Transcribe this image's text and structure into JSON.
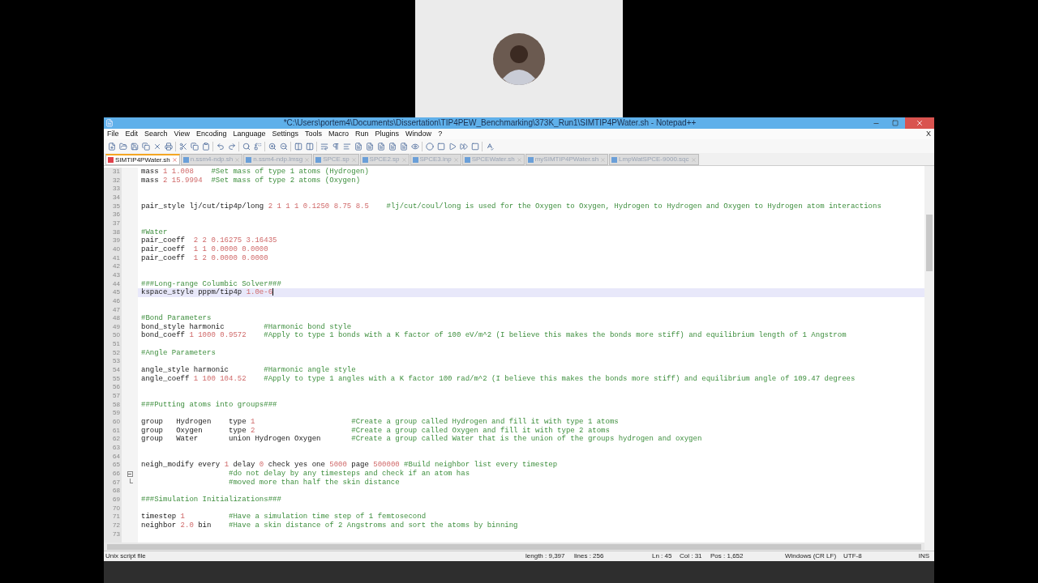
{
  "window": {
    "title": "*C:\\Users\\portem4\\Documents\\Dissertation\\TIP4PEW_Benchmarking\\373K_Run1\\SIMTIP4PWater.sh - Notepad++"
  },
  "menu": [
    "File",
    "Edit",
    "Search",
    "View",
    "Encoding",
    "Language",
    "Settings",
    "Tools",
    "Macro",
    "Run",
    "Plugins",
    "Window",
    "?"
  ],
  "menu_close": "X",
  "tabs": [
    {
      "label": "SIMTIP4PWater.sh",
      "selected": true
    },
    {
      "label": "n.ssm4-ndp.sh",
      "selected": false
    },
    {
      "label": "n.ssm4-ndp.lmsg",
      "selected": false
    },
    {
      "label": "SPCE.sp",
      "selected": false
    },
    {
      "label": "SPCE2.sp",
      "selected": false
    },
    {
      "label": "SPCE3.inp",
      "selected": false
    },
    {
      "label": "SPCEWater.sh",
      "selected": false
    },
    {
      "label": "mySIMTIP4PWater.sh",
      "selected": false
    },
    {
      "label": "LmpWatSPCE-9000.sqc",
      "selected": false
    }
  ],
  "editor": {
    "lines": [
      {
        "number": "31",
        "current": false,
        "segments": [
          {
            "kind": "code",
            "text": "mass "
          },
          {
            "kind": "number",
            "text": "1 1.008"
          },
          {
            "kind": "comment",
            "text": "    #Set mass of type 1 atoms (Hydrogen)"
          }
        ]
      },
      {
        "number": "32",
        "current": false,
        "segments": [
          {
            "kind": "code",
            "text": "mass "
          },
          {
            "kind": "number",
            "text": "2 15.9994"
          },
          {
            "kind": "comment",
            "text": "  #Set mass of type 2 atoms (Oxygen)"
          }
        ]
      },
      {
        "number": "33",
        "current": false
      },
      {
        "number": "34",
        "current": false
      },
      {
        "number": "35",
        "current": false,
        "segments": [
          {
            "kind": "code",
            "text": "pair_style lj/cut/tip4p/long "
          },
          {
            "kind": "number",
            "text": "2 1 1 1 0.1250 8.75 8.5"
          },
          {
            "kind": "comment",
            "text": "    #lj/cut/coul/long is used for the Oxygen to Oxygen, Hydrogen to Hydrogen and Oxygen to Hydrogen atom interactions"
          }
        ]
      },
      {
        "number": "36",
        "current": false
      },
      {
        "number": "37",
        "current": false
      },
      {
        "number": "38",
        "current": false,
        "segments": [
          {
            "kind": "comment",
            "text": "#Water"
          }
        ]
      },
      {
        "number": "39",
        "current": false,
        "segments": [
          {
            "kind": "code",
            "text": "pair_coeff  "
          },
          {
            "kind": "number",
            "text": "2 2 0.16275 3.16435"
          }
        ]
      },
      {
        "number": "40",
        "current": false,
        "segments": [
          {
            "kind": "code",
            "text": "pair_coeff  "
          },
          {
            "kind": "number",
            "text": "1 1 0.0000 0.0000"
          }
        ]
      },
      {
        "number": "41",
        "current": false,
        "segments": [
          {
            "kind": "code",
            "text": "pair_coeff  "
          },
          {
            "kind": "number",
            "text": "1 2 0.0000 0.0000"
          }
        ]
      },
      {
        "number": "42",
        "current": false
      },
      {
        "number": "43",
        "current": false
      },
      {
        "number": "44",
        "current": false,
        "segments": [
          {
            "kind": "comment",
            "text": "###Long-range Columbic Solver###"
          }
        ]
      },
      {
        "number": "45",
        "current": true,
        "segments": [
          {
            "kind": "code",
            "text": "kspace_style pppm/tip4p "
          },
          {
            "kind": "number",
            "text": "1.0e-6"
          }
        ]
      },
      {
        "number": "46",
        "current": false
      },
      {
        "number": "47",
        "current": false
      },
      {
        "number": "48",
        "current": false,
        "segments": [
          {
            "kind": "comment",
            "text": "#Bond Parameters"
          }
        ]
      },
      {
        "number": "49",
        "current": false,
        "segments": [
          {
            "kind": "code",
            "text": "bond_style harmonic"
          },
          {
            "kind": "comment",
            "text": "         #Harmonic bond style"
          }
        ]
      },
      {
        "number": "50",
        "current": false,
        "segments": [
          {
            "kind": "code",
            "text": "bond_coeff "
          },
          {
            "kind": "number",
            "text": "1 1000 0.9572"
          },
          {
            "kind": "comment",
            "text": "    #Apply to type 1 bonds with a K factor of 100 eV/m^2 (I believe this makes the bonds more stiff) and equilibrium length of 1 Angstrom"
          }
        ]
      },
      {
        "number": "51",
        "current": false
      },
      {
        "number": "52",
        "current": false,
        "segments": [
          {
            "kind": "comment",
            "text": "#Angle Parameters"
          }
        ]
      },
      {
        "number": "53",
        "current": false
      },
      {
        "number": "54",
        "current": false,
        "segments": [
          {
            "kind": "code",
            "text": "angle_style harmonic"
          },
          {
            "kind": "comment",
            "text": "        #Harmonic angle style"
          }
        ]
      },
      {
        "number": "55",
        "current": false,
        "segments": [
          {
            "kind": "code",
            "text": "angle_coeff "
          },
          {
            "kind": "number",
            "text": "1 100 104.52"
          },
          {
            "kind": "comment",
            "text": "    #Apply to type 1 angles with a K factor 100 rad/m^2 (I believe this makes the bonds more stiff) and equilibrium angle of 109.47 degrees"
          }
        ]
      },
      {
        "number": "56",
        "current": false
      },
      {
        "number": "57",
        "current": false
      },
      {
        "number": "58",
        "current": false,
        "segments": [
          {
            "kind": "comment",
            "text": "###Putting atoms into groups###"
          }
        ]
      },
      {
        "number": "59",
        "current": false
      },
      {
        "number": "60",
        "current": false,
        "segments": [
          {
            "kind": "code",
            "text": "group   Hydrogen    type "
          },
          {
            "kind": "number",
            "text": "1"
          },
          {
            "kind": "comment",
            "text": "                      #Create a group called Hydrogen and fill it with type 1 atoms"
          }
        ]
      },
      {
        "number": "61",
        "current": false,
        "segments": [
          {
            "kind": "code",
            "text": "group   Oxygen      type "
          },
          {
            "kind": "number",
            "text": "2"
          },
          {
            "kind": "comment",
            "text": "                      #Create a group called Oxygen and fill it with type 2 atoms"
          }
        ]
      },
      {
        "number": "62",
        "current": false,
        "segments": [
          {
            "kind": "code",
            "text": "group   Water       union Hydrogen Oxygen"
          },
          {
            "kind": "comment",
            "text": "       #Create a group called Water that is the union of the groups hydrogen and oxygen"
          }
        ]
      },
      {
        "number": "63",
        "current": false
      },
      {
        "number": "64",
        "current": false
      },
      {
        "number": "65",
        "current": false,
        "segments": [
          {
            "kind": "code",
            "text": "neigh_modify every "
          },
          {
            "kind": "number",
            "text": "1"
          },
          {
            "kind": "code",
            "text": " delay "
          },
          {
            "kind": "number",
            "text": "0"
          },
          {
            "kind": "code",
            "text": " check yes one "
          },
          {
            "kind": "number",
            "text": "5000"
          },
          {
            "kind": "code",
            "text": " page "
          },
          {
            "kind": "number",
            "text": "500000"
          },
          {
            "kind": "comment",
            "text": " #Build neighbor list every timestep"
          }
        ]
      },
      {
        "number": "66",
        "current": false,
        "kind": "fold_start",
        "segments": [
          {
            "kind": "comment",
            "text": "                    #do not delay by any timesteps and check if an atom has"
          }
        ]
      },
      {
        "number": "67",
        "current": false,
        "kind": "fold_end",
        "segments": [
          {
            "kind": "comment",
            "text": "                    #moved more than half the skin distance"
          }
        ]
      },
      {
        "number": "68",
        "current": false
      },
      {
        "number": "69",
        "current": false,
        "segments": [
          {
            "kind": "comment",
            "text": "###Simulation Initializations###"
          }
        ]
      },
      {
        "number": "70",
        "current": false
      },
      {
        "number": "71",
        "current": false,
        "segments": [
          {
            "kind": "code",
            "text": "timestep "
          },
          {
            "kind": "number",
            "text": "1"
          },
          {
            "kind": "comment",
            "text": "          #Have a simulation time step of 1 femtosecond"
          }
        ]
      },
      {
        "number": "72",
        "current": false,
        "segments": [
          {
            "kind": "code",
            "text": "neighbor "
          },
          {
            "kind": "number",
            "text": "2.0"
          },
          {
            "kind": "code",
            "text": " bin"
          },
          {
            "kind": "comment",
            "text": "    #Have a skin distance of 2 Angstroms and sort the atoms by binning"
          }
        ]
      },
      {
        "number": "73",
        "current": false
      }
    ]
  },
  "status_bar": {
    "file_type": "Unix script file",
    "length": "length : 9,397",
    "lines": "lines : 256",
    "ln": "Ln : 45",
    "col": "Col : 31",
    "pos": "Pos : 1,652",
    "eol": "Windows (CR LF)",
    "encoding": "UTF-8",
    "mode": "INS"
  }
}
